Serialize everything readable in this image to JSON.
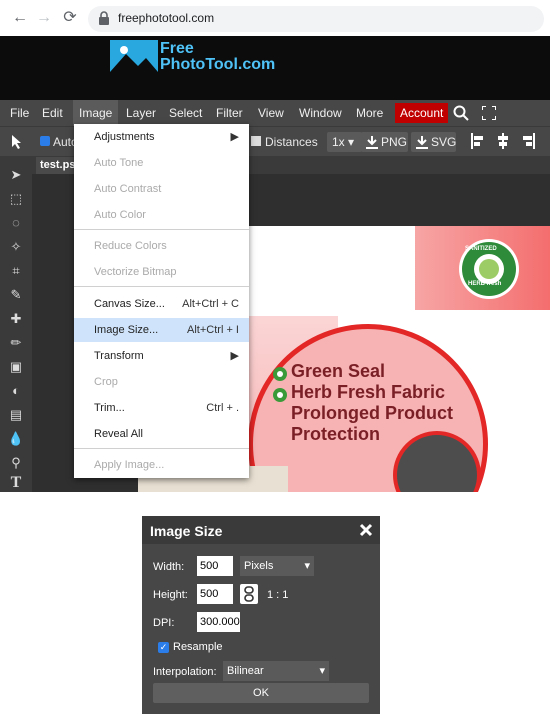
{
  "browser": {
    "url": "freephototool.com",
    "back": "←",
    "forward": "→",
    "reload": "⟳"
  },
  "site": {
    "logo_line1": "Free",
    "logo_line2": "PhotoTool.com"
  },
  "menubar": {
    "items": [
      "File",
      "Edit",
      "Image",
      "Layer",
      "Select",
      "Filter",
      "View",
      "Window",
      "More"
    ],
    "account": "Account"
  },
  "toolbar": {
    "auto_label": "Auto",
    "distances_label": "Distances",
    "zoom_value": "1x",
    "png_label": "PNG",
    "svg_label": "SVG"
  },
  "document": {
    "tab_name": "test.ps"
  },
  "image_menu": {
    "items": [
      {
        "label": "Adjustments",
        "shortcut": "",
        "disabled": false,
        "submenu": true
      },
      {
        "label": "Auto Tone",
        "shortcut": "",
        "disabled": true
      },
      {
        "label": "Auto Contrast",
        "shortcut": "",
        "disabled": true
      },
      {
        "label": "Auto Color",
        "shortcut": "",
        "disabled": true
      },
      {
        "label": "Reduce Colors",
        "shortcut": "",
        "disabled": true
      },
      {
        "label": "Vectorize Bitmap",
        "shortcut": "",
        "disabled": true
      },
      {
        "label": "Canvas Size...",
        "shortcut": "Alt+Ctrl + C",
        "disabled": false
      },
      {
        "label": "Image Size...",
        "shortcut": "Alt+Ctrl + I",
        "disabled": false,
        "highlighted": true
      },
      {
        "label": "Transform",
        "shortcut": "",
        "disabled": false,
        "submenu": true
      },
      {
        "label": "Crop",
        "shortcut": "",
        "disabled": true
      },
      {
        "label": "Trim...",
        "shortcut": "Ctrl + .",
        "disabled": false
      },
      {
        "label": "Reveal All",
        "shortcut": "",
        "disabled": false
      },
      {
        "label": "Apply Image...",
        "shortcut": "",
        "disabled": true
      }
    ]
  },
  "canvas_content": {
    "line1": "Green Seal",
    "line2": "Herb Fresh Fabric",
    "line3": "Prolonged Product",
    "line4": "Protection",
    "badge_top": "SANITIZED",
    "badge_bottom": "HERB fresh"
  },
  "dialog": {
    "title": "Image Size",
    "width_label": "Width:",
    "width_value": "500",
    "unit": "Pixels",
    "height_label": "Height:",
    "height_value": "500",
    "ratio": "1 : 1",
    "dpi_label": "DPI:",
    "dpi_value": "300.000",
    "resample_label": "Resample",
    "interpolation_label": "Interpolation:",
    "interpolation_value": "Bilinear",
    "ok_label": "OK"
  },
  "colors": {
    "account_bg": "#c00000",
    "menubar_bg": "#474747",
    "highlight": "#cfe4fb",
    "headline": "#7a1f26",
    "seal_green": "#2e8b3a"
  }
}
